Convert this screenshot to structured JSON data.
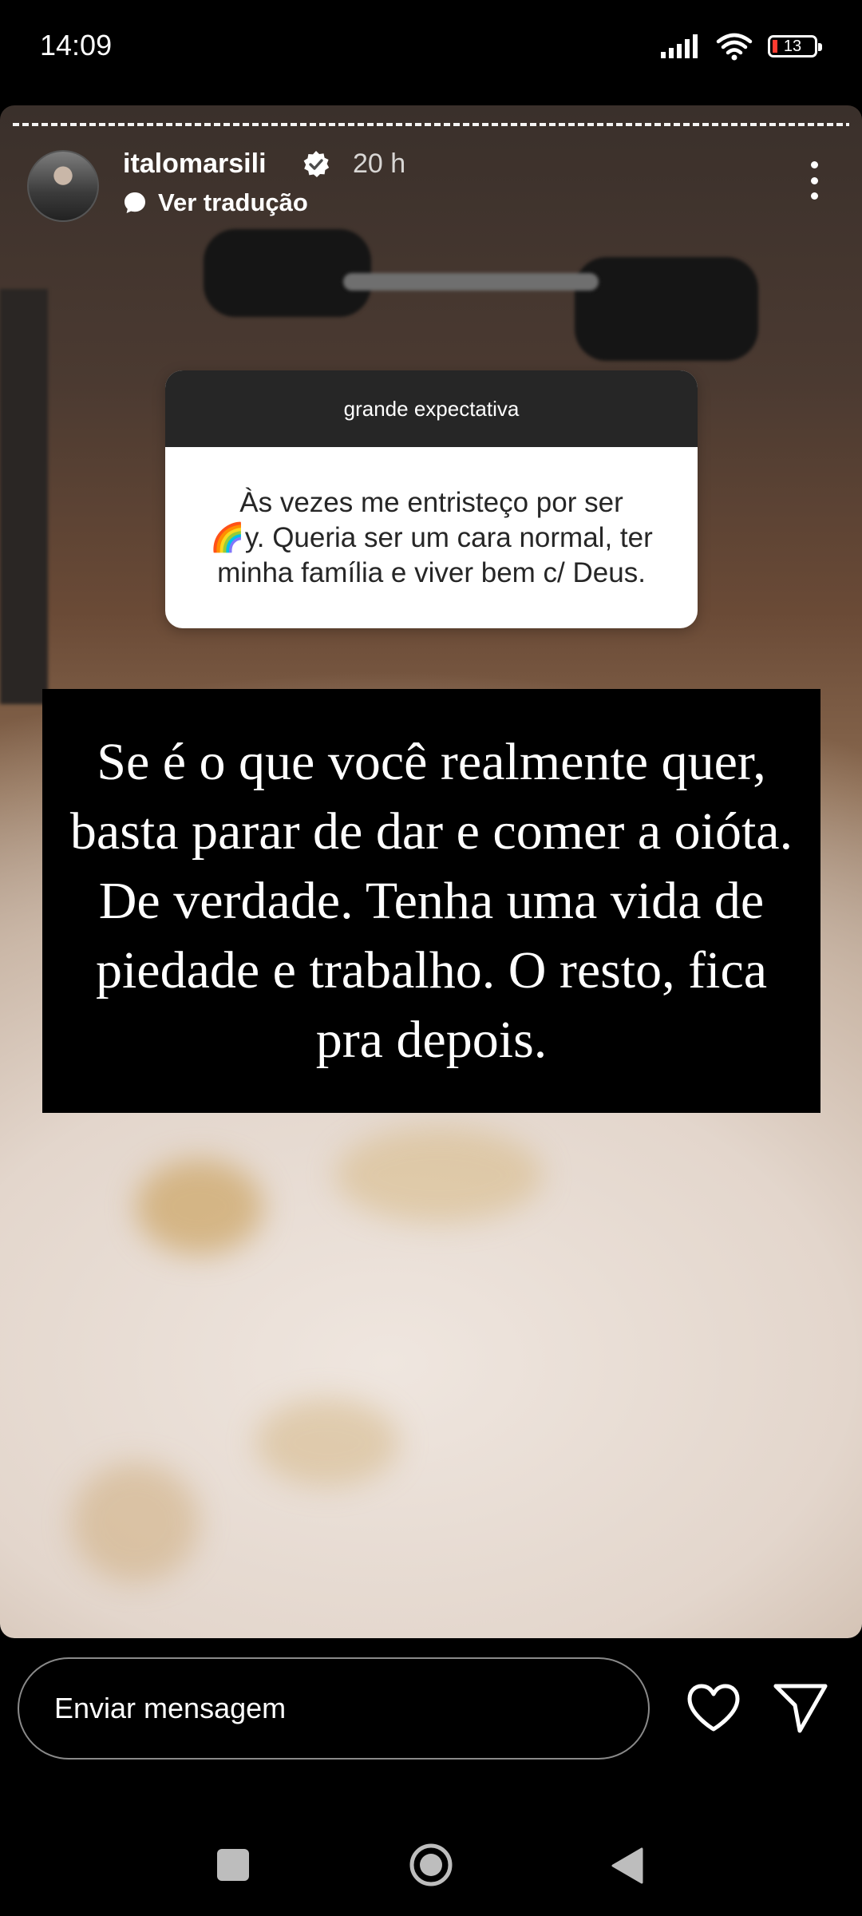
{
  "status_bar": {
    "time": "14:09",
    "battery": "13",
    "icons": [
      "signal-icon",
      "wifi-icon",
      "battery-icon"
    ]
  },
  "story": {
    "username": "italomarsili",
    "time_ago": "20 h",
    "translate_label": "Ver tradução",
    "question_sticker": {
      "title": "grande expectativa",
      "text_before": "Às vezes me entristeço por ser",
      "text_emoji": "🌈",
      "text_after": "y. Queria ser um cara normal, ter minha família e viver bem c/ Deus."
    },
    "answer_text": "Se é o que você realmente quer, basta parar de dar e comer a oióta. De verdade. Tenha uma vida de piedade e trabalho. O resto, fica pra depois.",
    "progress_segments": 1
  },
  "reply": {
    "placeholder": "Enviar mensagem",
    "icons": [
      "heart-icon",
      "send-icon"
    ]
  },
  "nav": {
    "icons": [
      "recent-apps-icon",
      "home-icon",
      "back-icon"
    ]
  },
  "colors": {
    "background": "#000000",
    "sticker_header": "#262626",
    "battery_low": "#ff3b30"
  }
}
